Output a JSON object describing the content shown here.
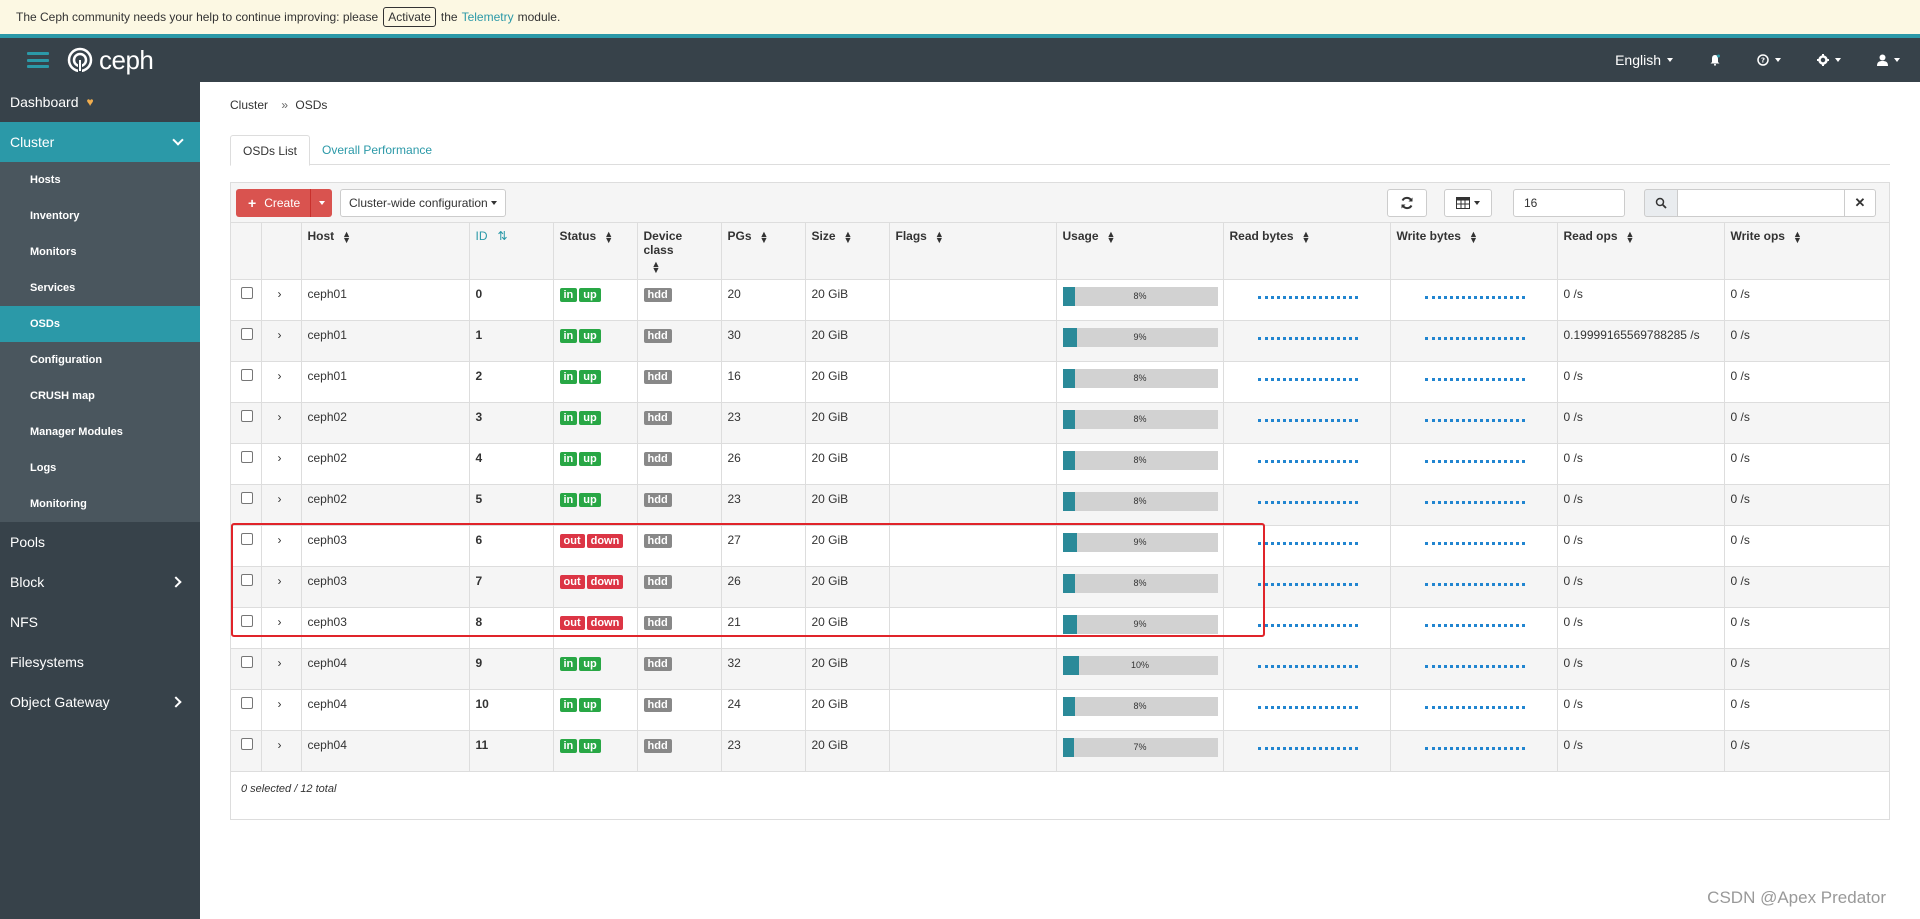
{
  "notice": {
    "before": "The Ceph community needs your help to continue improving: please",
    "activate_label": "Activate",
    "middle": "the",
    "telemetry_link": "Telemetry",
    "after": "module."
  },
  "navbar": {
    "brand": "ceph",
    "language": "English"
  },
  "sidebar": {
    "dashboard": "Dashboard",
    "cluster": "Cluster",
    "cluster_items": [
      "Hosts",
      "Inventory",
      "Monitors",
      "Services",
      "OSDs",
      "Configuration",
      "CRUSH map",
      "Manager Modules",
      "Logs",
      "Monitoring"
    ],
    "pools": "Pools",
    "block": "Block",
    "nfs": "NFS",
    "filesystems": "Filesystems",
    "object_gateway": "Object Gateway"
  },
  "breadcrumb": {
    "root": "Cluster",
    "sep": "»",
    "current": "OSDs"
  },
  "tabs": [
    "OSDs List",
    "Overall Performance"
  ],
  "toolbar": {
    "create_label": "Create",
    "cluster_config_label": "Cluster-wide configuration",
    "limit_value": "16"
  },
  "table": {
    "headers": [
      "Host",
      "ID",
      "Status",
      "Device class",
      "PGs",
      "Size",
      "Flags",
      "Usage",
      "Read bytes",
      "Write bytes",
      "Read ops",
      "Write ops"
    ],
    "rows": [
      {
        "host": "ceph01",
        "id": "0",
        "status": [
          "in",
          "up"
        ],
        "device_class": "hdd",
        "pgs": "20",
        "size": "20 GiB",
        "flags": "",
        "usage_pct": "8%",
        "usage": 0.08,
        "read_ops": "0 /s",
        "write_ops": "0 /s"
      },
      {
        "host": "ceph01",
        "id": "1",
        "status": [
          "in",
          "up"
        ],
        "device_class": "hdd",
        "pgs": "30",
        "size": "20 GiB",
        "flags": "",
        "usage_pct": "9%",
        "usage": 0.09,
        "read_ops": "0.19999165569788285 /s",
        "write_ops": "0 /s"
      },
      {
        "host": "ceph01",
        "id": "2",
        "status": [
          "in",
          "up"
        ],
        "device_class": "hdd",
        "pgs": "16",
        "size": "20 GiB",
        "flags": "",
        "usage_pct": "8%",
        "usage": 0.08,
        "read_ops": "0 /s",
        "write_ops": "0 /s"
      },
      {
        "host": "ceph02",
        "id": "3",
        "status": [
          "in",
          "up"
        ],
        "device_class": "hdd",
        "pgs": "23",
        "size": "20 GiB",
        "flags": "",
        "usage_pct": "8%",
        "usage": 0.08,
        "read_ops": "0 /s",
        "write_ops": "0 /s"
      },
      {
        "host": "ceph02",
        "id": "4",
        "status": [
          "in",
          "up"
        ],
        "device_class": "hdd",
        "pgs": "26",
        "size": "20 GiB",
        "flags": "",
        "usage_pct": "8%",
        "usage": 0.08,
        "read_ops": "0 /s",
        "write_ops": "0 /s"
      },
      {
        "host": "ceph02",
        "id": "5",
        "status": [
          "in",
          "up"
        ],
        "device_class": "hdd",
        "pgs": "23",
        "size": "20 GiB",
        "flags": "",
        "usage_pct": "8%",
        "usage": 0.08,
        "read_ops": "0 /s",
        "write_ops": "0 /s"
      },
      {
        "host": "ceph03",
        "id": "6",
        "status": [
          "out",
          "down"
        ],
        "device_class": "hdd",
        "pgs": "27",
        "size": "20 GiB",
        "flags": "",
        "usage_pct": "9%",
        "usage": 0.09,
        "read_ops": "0 /s",
        "write_ops": "0 /s"
      },
      {
        "host": "ceph03",
        "id": "7",
        "status": [
          "out",
          "down"
        ],
        "device_class": "hdd",
        "pgs": "26",
        "size": "20 GiB",
        "flags": "",
        "usage_pct": "8%",
        "usage": 0.08,
        "read_ops": "0 /s",
        "write_ops": "0 /s"
      },
      {
        "host": "ceph03",
        "id": "8",
        "status": [
          "out",
          "down"
        ],
        "device_class": "hdd",
        "pgs": "21",
        "size": "20 GiB",
        "flags": "",
        "usage_pct": "9%",
        "usage": 0.09,
        "read_ops": "0 /s",
        "write_ops": "0 /s"
      },
      {
        "host": "ceph04",
        "id": "9",
        "status": [
          "in",
          "up"
        ],
        "device_class": "hdd",
        "pgs": "32",
        "size": "20 GiB",
        "flags": "",
        "usage_pct": "10%",
        "usage": 0.1,
        "read_ops": "0 /s",
        "write_ops": "0 /s"
      },
      {
        "host": "ceph04",
        "id": "10",
        "status": [
          "in",
          "up"
        ],
        "device_class": "hdd",
        "pgs": "24",
        "size": "20 GiB",
        "flags": "",
        "usage_pct": "8%",
        "usage": 0.08,
        "read_ops": "0 /s",
        "write_ops": "0 /s"
      },
      {
        "host": "ceph04",
        "id": "11",
        "status": [
          "in",
          "up"
        ],
        "device_class": "hdd",
        "pgs": "23",
        "size": "20 GiB",
        "flags": "",
        "usage_pct": "7%",
        "usage": 0.07,
        "read_ops": "0 /s",
        "write_ops": "0 /s"
      }
    ]
  },
  "footer": {
    "count": "0 selected / 12 total"
  },
  "watermark": "CSDN @Apex   Predator",
  "colors": {
    "accent": "#2b99a8",
    "danger": "#dc3545",
    "success": "#28a745",
    "nav_bg": "#37424a",
    "highlight": "#e0242a"
  }
}
